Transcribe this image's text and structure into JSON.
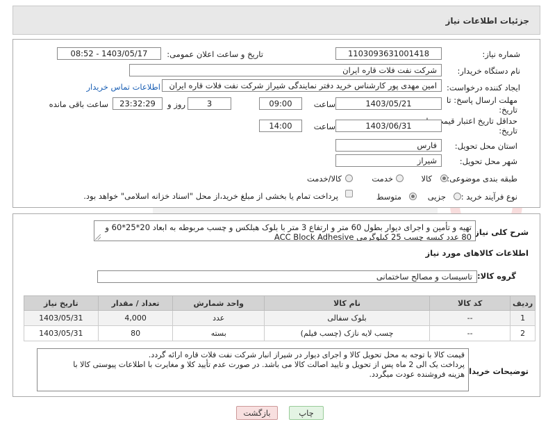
{
  "header": {
    "title": "جزئیات اطلاعات نیاز"
  },
  "fields": {
    "need_number_label": "شماره نیاز:",
    "need_number": "1103093631001418",
    "announce_label": "تاریخ و ساعت اعلان عمومی:",
    "announce_value": "1403/05/17 - 08:52",
    "buyer_org_label": "نام دستگاه خریدار:",
    "buyer_org": "شرکت نفت فلات قاره ایران",
    "creator_label": "ایجاد کننده درخواست:",
    "creator": "امین مهدی پور کارشناس خرید دفتر نمایندگی شیراز شرکت نفت فلات قاره ایران",
    "contact_link": "اطلاعات تماس خریدار",
    "deadline_label": "مهلت ارسال پاسخ: تا",
    "deadline_label2": "تاریخ:",
    "deadline_date": "1403/05/21",
    "time_label": "ساعت",
    "deadline_time": "09:00",
    "days_value": "3",
    "days_label": "روز و",
    "remaining_time": "23:32:29",
    "remaining_label": "ساعت باقی مانده",
    "validity_label": "حداقل تاریخ اعتبار قیمت: تا",
    "validity_label2": "تاریخ:",
    "validity_date": "1403/06/31",
    "validity_time_label": "ساعت",
    "validity_time": "14:00",
    "province_label": "استان محل تحویل:",
    "province": "فارس",
    "city_label": "شهر محل تحویل:",
    "city": "شیراز",
    "category_label": "طبقه بندی موضوعی:",
    "category_options": [
      "کالا",
      "خدمت",
      "کالا/خدمت"
    ],
    "process_label": "نوع فرآیند خرید :",
    "process_options": [
      "جزیی",
      "متوسط"
    ],
    "payment_note": "پرداخت تمام یا بخشی از مبلغ خرید،از محل \"اسناد خزانه اسلامی\" خواهد بود."
  },
  "description": {
    "label": "شرح کلی نیاز:",
    "line1": "تهیه و تأمین و اجرای دیوار بطول 60 متر و ارتفاع 3 متر با بلوک هبلکس و چسب مربوطه به ابعاد 20*25*60 و",
    "line2": "80 عدد کیسه چسب 25 کیلوگرمی ACC Block Adhesive"
  },
  "goods": {
    "section_title": "اطلاعات کالاهای مورد نیاز",
    "group_label": "گروه کالا:",
    "group_value": "تاسیسات و مصالح ساختمانی",
    "columns": [
      "ردیف",
      "کد کالا",
      "نام کالا",
      "واحد شمارش",
      "تعداد / مقدار",
      "تاریخ نیاز"
    ],
    "rows": [
      [
        "1",
        "--",
        "بلوک سفالی",
        "عدد",
        "4,000",
        "1403/05/31"
      ],
      [
        "2",
        "--",
        "چسب لایه نازک (چسب فیلم)",
        "بسته",
        "80",
        "1403/05/31"
      ]
    ]
  },
  "buyer_notes": {
    "label": "توضیحات خریدار:",
    "line1": "قیمت کالا با توجه به محل تحویل کالا و اجرای دیوار در شیراز انبار شرکت نفت فلات قاره ارائه گردد.",
    "line2": "پرداخت یک الی 2 ماه پس از تحویل و تایید اصالت کالا می باشد. در صورت عدم تأیید کلا و مغایرت با اطلاعات پیوستی کالا با",
    "line3": "هزینه فروشنده عودت میگردد."
  },
  "buttons": {
    "print": "چاپ",
    "back": "بازگشت"
  },
  "colors": {
    "link": "#1a5fb4",
    "header_bg": "#e8e8e8",
    "table_header_bg": "#d3d3d3"
  }
}
